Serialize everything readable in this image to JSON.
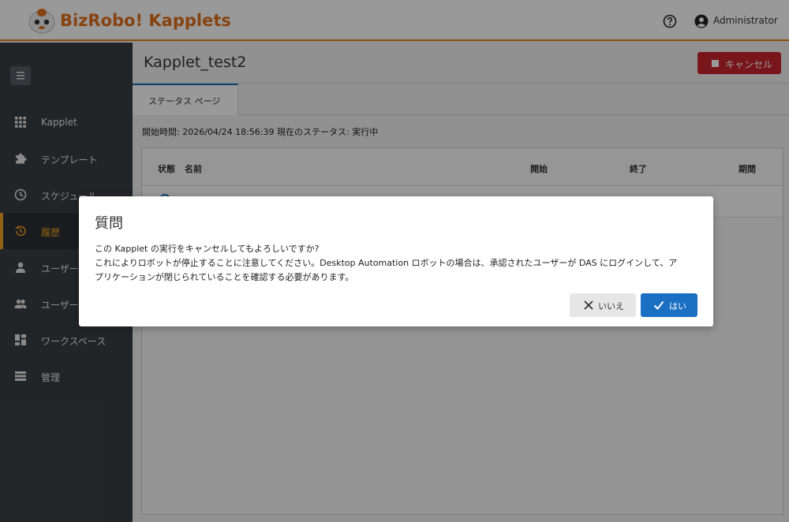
{
  "header": {
    "brand": "BizRobo! Kapplets",
    "user": "Administrator"
  },
  "sidebar": {
    "items": [
      {
        "label": "Kapplet",
        "icon": "grid-icon"
      },
      {
        "label": "テンプレート",
        "icon": "puzzle-icon"
      },
      {
        "label": "スケジュール",
        "icon": "clock-icon"
      },
      {
        "label": "履歴",
        "icon": "history-icon",
        "active": true
      },
      {
        "label": "ユーザー",
        "icon": "user-icon"
      },
      {
        "label": "ユーザー",
        "icon": "users-icon"
      },
      {
        "label": "ワークスペース",
        "icon": "dashboard-icon"
      },
      {
        "label": "管理",
        "icon": "list-icon"
      }
    ]
  },
  "main": {
    "title": "Kapplet_test2",
    "cancel_label": "キャンセル",
    "tab_label": "ステータス ページ",
    "status_line": "開始時間: 2026/04/24 18:56:39 現在のステータス: 実行中",
    "table": {
      "columns": [
        "状態",
        "名前",
        "開始",
        "終了",
        "期間"
      ]
    }
  },
  "modal": {
    "title": "質問",
    "lines": [
      "この Kapplet の実行をキャンセルしてもよろしいですか?",
      "これによりロボットが停止することに注意してください。Desktop Automation ロボットの場合は、承認されたユーザーが DAS にログインして、ア",
      "プリケーションが閉じられていることを確認する必要があります。"
    ],
    "no_label": "いいえ",
    "yes_label": "はい"
  },
  "colors": {
    "brand_orange": "#e2701b",
    "primary_blue": "#1b6fc2",
    "danger_red": "#c9252d",
    "sidebar_bg": "#3a3f44",
    "active_accent": "#f0a020"
  }
}
